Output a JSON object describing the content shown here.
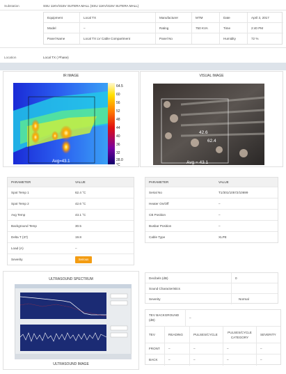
{
  "substation": {
    "label": "Substation",
    "value": "SSU 11KV/415V SUTERA MALL (SSU 11KV/415V SUTERA MALL)"
  },
  "info_grid": {
    "rows": [
      [
        {
          "k": "Equipment",
          "v": "Local TX"
        },
        {
          "k": "Manufacturer",
          "v": "MTM"
        },
        {
          "k": "Date",
          "v": "April 3, 2017"
        }
      ],
      [
        {
          "k": "Model",
          "v": "–"
        },
        {
          "k": "Rating",
          "v": "750 KVA"
        },
        {
          "k": "Time",
          "v": "2:40 PM"
        }
      ],
      [
        {
          "k": "Panel Name",
          "v": "Local TX LV Cable Compartment"
        },
        {
          "k": "Panel No",
          "v": ""
        },
        {
          "k": "Humidity",
          "v": "72 %"
        }
      ]
    ]
  },
  "location": {
    "label": "Location",
    "value": "Local TX ( Phase)"
  },
  "ir_image": {
    "title": "IR IMAGE",
    "scale_ticks": [
      "64.5",
      "60",
      "56",
      "52",
      "48",
      "44",
      "40",
      "36",
      "32",
      "28.0"
    ],
    "unit": "°C",
    "avg_label": "Avg=43.1"
  },
  "visual_image": {
    "title": "VISUAL IMAGE",
    "spot1": "42.6",
    "spot2": "62.4",
    "avg_label": "Avg = 43.1"
  },
  "ir_table": {
    "headers": [
      "PARAMETER",
      "VALUE"
    ],
    "rows": [
      [
        "Spot Temp 1",
        "62.4 °C"
      ],
      [
        "Spot Temp 2",
        "42.6 °C"
      ],
      [
        "Avg Temp",
        "43.1 °C"
      ],
      [
        "Background Temp",
        "30.5"
      ],
      [
        "Delta T (37)",
        "19.8"
      ],
      [
        "Load (A)",
        "–"
      ],
      [
        "Severity",
        ""
      ]
    ],
    "severity_badge": "Serious",
    "severity_color": "#f39c12"
  },
  "visual_table": {
    "headers": [
      "PARAMETER",
      "VALUE"
    ],
    "rows": [
      [
        "Serial No",
        "T1/301/10572/10699"
      ],
      [
        "Heater On/Off",
        "–"
      ],
      [
        "CB Position",
        "–"
      ],
      [
        "Busbar Position",
        "–"
      ],
      [
        "Cable Type",
        "XLPE"
      ]
    ]
  },
  "ultrasound": {
    "title": "ULTRASOUND SPECTRUM",
    "caption": "ULTRASOUND IMAGE"
  },
  "decibel_table": {
    "rows": [
      [
        "Decibels (dB)",
        "0"
      ],
      [
        "Sound Characteristics",
        ""
      ],
      [
        "Severity",
        "Normal"
      ]
    ]
  },
  "tev_table": {
    "background_label": "TEV BACKGROUND (dB)",
    "background_value": "–",
    "headers": [
      "TEV",
      "READING",
      "PULSES/CYCLE",
      "PULSES/CYCLE CATEGORY",
      "SEVERITY"
    ],
    "rows": [
      [
        "FRONT",
        "–",
        "–",
        "–",
        "–"
      ],
      [
        "BACK",
        "–",
        "–",
        "–",
        "–"
      ]
    ]
  }
}
